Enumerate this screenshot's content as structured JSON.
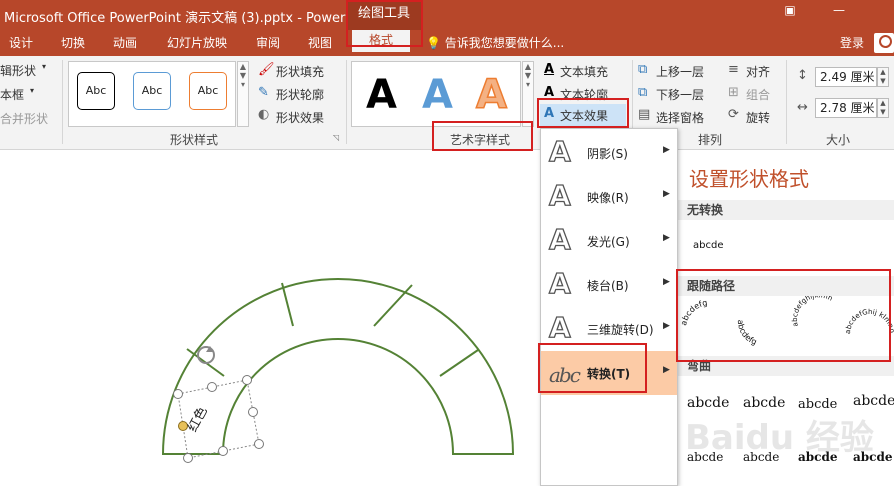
{
  "window": {
    "title": "Microsoft Office PowerPoint 演示文稿 (3).pptx - PowerP...",
    "context_tab": "绘图工具",
    "restore_symbol": "▣",
    "minimize_symbol": "—"
  },
  "tabs": [
    "设计",
    "切换",
    "动画",
    "幻灯片放映",
    "审阅",
    "视图"
  ],
  "active_tab": "格式",
  "tell_me": "告诉我您想要做什么...",
  "login": "登录",
  "ribbon": {
    "insert_shapes": {
      "edit_shape": "辑形状",
      "text_box": "本框",
      "merge_shapes": "合并形状"
    },
    "shape_styles": {
      "sample": "Abc",
      "fill": "形状填充",
      "outline": "形状轮廓",
      "effects": "形状效果",
      "label": "形状样式",
      "colors": [
        "#000000",
        "#5b9bd5",
        "#ed7d31"
      ]
    },
    "wordart": {
      "glyph": "A",
      "fill": "文本填充",
      "outline": "文本轮廓",
      "effects": "文本效果",
      "label": "艺术字样式"
    },
    "arrange": {
      "bring_forward": "上移一层",
      "send_backward": "下移一层",
      "selection_pane": "选择窗格",
      "align": "对齐",
      "group": "组合",
      "rotate": "旋转",
      "label": "排列"
    },
    "size": {
      "height": "2.49 厘米",
      "width": "2.78 厘米",
      "label": "大小"
    }
  },
  "text_effects_menu": [
    {
      "label": "阴影(S)",
      "glyph": "A"
    },
    {
      "label": "映像(R)",
      "glyph": "A"
    },
    {
      "label": "发光(G)",
      "glyph": "A"
    },
    {
      "label": "棱台(B)",
      "glyph": "A"
    },
    {
      "label": "三维旋转(D)",
      "glyph": "A"
    },
    {
      "label": "转换(T)",
      "glyph": "abc"
    }
  ],
  "format_pane": {
    "title": "设置形状格式"
  },
  "transform_submenu": {
    "no_transform": {
      "heading": "无转换",
      "sample": "abcde"
    },
    "follow_path": {
      "heading": "跟随路径",
      "samples": [
        "abcdefg",
        "abcdefg",
        "abcdefghijklmn",
        "abcdefGhij klmnop"
      ]
    },
    "warp": {
      "heading": "弯曲",
      "sample": "abcde"
    }
  },
  "slide": {
    "selected_text": "红色"
  },
  "watermark": "Baidu 经验"
}
